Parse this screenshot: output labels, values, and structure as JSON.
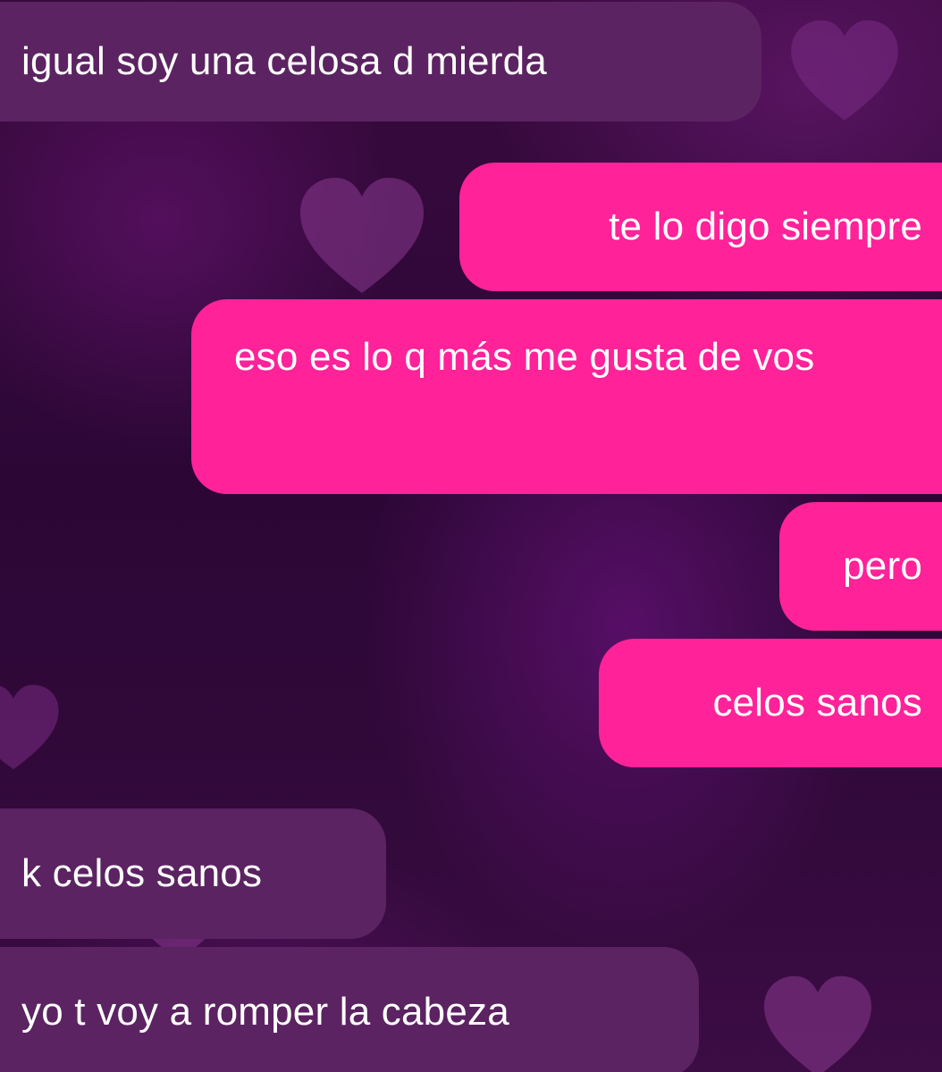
{
  "conversation": {
    "messages": [
      {
        "direction": "received",
        "text": "igual soy una celosa d mierda"
      },
      {
        "direction": "sent",
        "text": "te lo digo siempre"
      },
      {
        "direction": "sent",
        "text": "eso es lo q más me gusta de vos"
      },
      {
        "direction": "sent",
        "text": "pero"
      },
      {
        "direction": "sent",
        "text": "celos sanos"
      },
      {
        "direction": "received",
        "text": "k celos sanos"
      },
      {
        "direction": "received",
        "text": "yo t voy a romper la cabeza"
      }
    ]
  },
  "colors": {
    "sent_bubble": "#ff2299",
    "received_bubble": "#5b2361",
    "background": "#2c0736",
    "text": "#ffffff"
  },
  "background_icons": [
    "heart-icon"
  ]
}
